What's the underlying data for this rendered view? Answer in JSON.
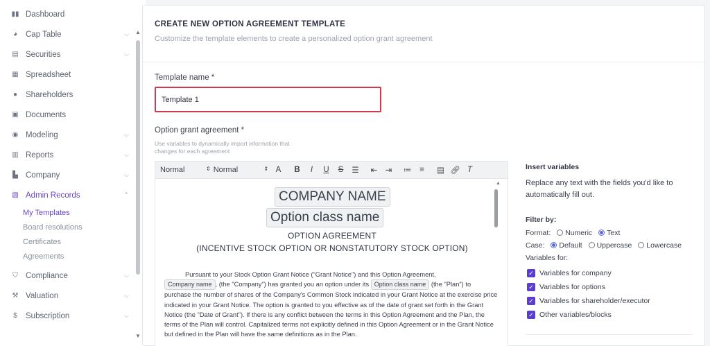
{
  "sidebar": {
    "items": [
      {
        "label": "Dashboard",
        "icon": "dashboard-icon"
      },
      {
        "label": "Cap Table",
        "icon": "pie-chart-icon"
      },
      {
        "label": "Securities",
        "icon": "document-icon"
      },
      {
        "label": "Spreadsheet",
        "icon": "grid-icon"
      },
      {
        "label": "Shareholders",
        "icon": "person-icon"
      },
      {
        "label": "Documents",
        "icon": "folder-icon"
      },
      {
        "label": "Modeling",
        "icon": "bulb-icon"
      },
      {
        "label": "Reports",
        "icon": "report-icon"
      },
      {
        "label": "Company",
        "icon": "building-icon"
      },
      {
        "label": "Admin Records",
        "icon": "records-icon"
      },
      {
        "label": "Compliance",
        "icon": "shield-icon"
      },
      {
        "label": "Valuation",
        "icon": "gavel-icon"
      },
      {
        "label": "Subscription",
        "icon": "dollar-icon"
      }
    ],
    "admin_sub": [
      "My Templates",
      "Board resolutions",
      "Certificates",
      "Agreements"
    ]
  },
  "header": {
    "title": "CREATE NEW OPTION AGREEMENT TEMPLATE",
    "subtitle": "Customize the template elements to create a personalized option grant agreement"
  },
  "form": {
    "name_label": "Template name *",
    "name_value": "Template 1",
    "agreement_label": "Option grant agreement *",
    "hint": "Use variables to dynamically import information that changes for each agreement"
  },
  "toolbar": {
    "style_select": "Normal",
    "font_select": "Normal"
  },
  "editor": {
    "company_chip": "COMPANY NAME",
    "class_chip": "Option class name",
    "heading1": "OPTION AGREEMENT",
    "heading2": "(INCENTIVE STOCK OPTION OR NONSTATUTORY STOCK OPTION)",
    "p_intro": "Pursuant to your Stock Option Grant Notice (\"Grant Notice\") and this Option Agreement,",
    "chip_company": "Company name",
    "p_mid1": ", (the \"Company\") has granted you an option under its",
    "chip_class": "Option class name",
    "p_mid2": "(the \"Plan\") to purchase the number of shares of the Company's Common Stock indicated in your Grant Notice at the exercise price indicated in your Grant Notice. The option is granted to you effective as of the date of grant set forth in the Grant Notice (the \"Date of Grant\"). If there is any conflict between the terms in this Option Agreement and the Plan, the terms of the Plan will control. Capitalized terms not explicitly defined in this Option Agreement or in the Grant Notice but defined in the Plan will have the same definitions as in the Plan."
  },
  "panel": {
    "title": "Insert variables",
    "desc": "Replace any text with the fields you'd like to automatically fill out.",
    "filter_by": "Filter by:",
    "format_label": "Format:",
    "format_opt1": "Numeric",
    "format_opt2": "Text",
    "case_label": "Case:",
    "case_opt1": "Default",
    "case_opt2": "Uppercase",
    "case_opt3": "Lowercase",
    "vars_for": "Variables for:",
    "checks": [
      "Variables for company",
      "Variables for options",
      "Variables for shareholder/executor",
      "Other variables/blocks"
    ]
  }
}
